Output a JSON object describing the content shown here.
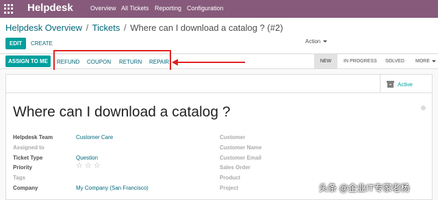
{
  "navbar": {
    "brand": "Helpdesk",
    "menu": [
      "Overview",
      "All Tickets",
      "Reporting",
      "Configuration"
    ]
  },
  "breadcrumb": {
    "items": [
      "Helpdesk Overview",
      "Tickets"
    ],
    "separator": "/",
    "current": "Where can I download a catalog ? (#2)"
  },
  "controls": {
    "edit_label": "EDIT",
    "create_label": "CREATE",
    "action_label": "Action"
  },
  "statusbar": {
    "assign_label": "ASSIGN TO ME",
    "header_buttons": [
      "REFUND",
      "COUPON",
      "RETURN",
      "REPAIR"
    ],
    "stages": [
      "NEW",
      "IN PROGRESS",
      "SOLVED",
      "MORE"
    ],
    "active_stage": "NEW"
  },
  "sheet": {
    "active_button": "Active",
    "title": "Where can I download a catalog ?",
    "left_fields": [
      {
        "label": "Helpdesk Team",
        "value": "Customer Care"
      },
      {
        "label": "Assigned to",
        "value": ""
      },
      {
        "label": "Ticket Type",
        "value": "Question"
      },
      {
        "label": "Priority",
        "value": ""
      },
      {
        "label": "Tags",
        "value": ""
      },
      {
        "label": "Company",
        "value": "My Company (San Francisco)"
      }
    ],
    "priority": {
      "rating": 0,
      "max": 3
    },
    "right_fields": [
      "Customer",
      "Customer Name",
      "Customer Email",
      "Sales Order",
      "Product",
      "Project"
    ]
  },
  "watermark": "头条 @企业IT专家老杨",
  "colors": {
    "navbar": "#875a7b",
    "primary_button": "#00a09d",
    "link": "#00677a",
    "highlight": "#e02020"
  }
}
